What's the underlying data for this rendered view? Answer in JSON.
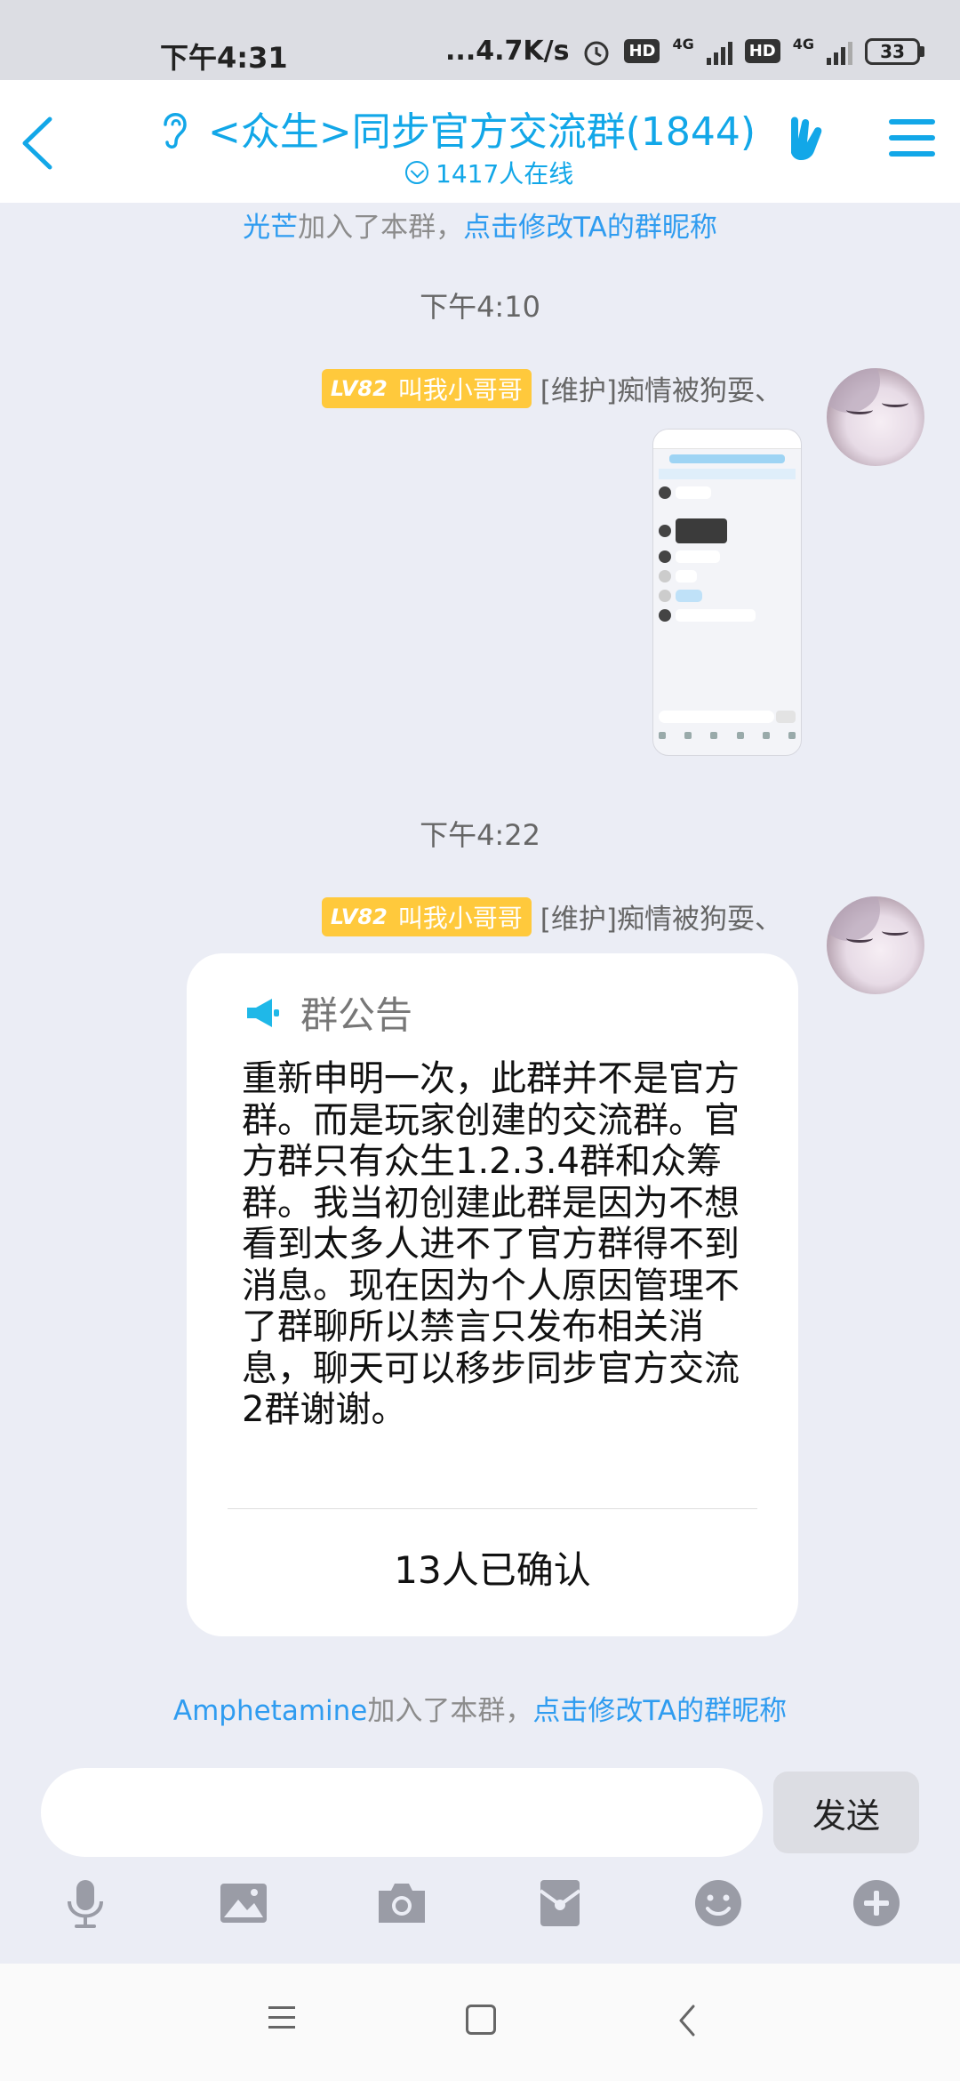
{
  "status_bar": {
    "time": "下午4:31",
    "network_speed": "...4.7K/s",
    "hd1": "HD",
    "hd2": "HD",
    "net1": "4G",
    "net2": "4G",
    "battery": "33"
  },
  "header": {
    "title": "<众生>同步官方交流群(1844)",
    "online_count": "1417人在线"
  },
  "chat": {
    "sys_top": {
      "name": "光芒",
      "text": "加入了本群，",
      "link": "点击修改TA的群昵称"
    },
    "messages": [
      {
        "time": "下午4:10",
        "level": "LV82",
        "title": "叫我小哥哥",
        "sender": "[维护]痴情被狗耍、",
        "type": "image"
      },
      {
        "time": "下午4:22",
        "level": "LV82",
        "title": "叫我小哥哥",
        "sender": "[维护]痴情被狗耍、",
        "type": "notice",
        "notice_title": "群公告",
        "notice_body": "重新申明一次，此群并不是官方群。而是玩家创建的交流群。官方群只有众生1.2.3.4群和众筹群。我当初创建此群是因为不想看到太多人进不了官方群得不到消息。现在因为个人原因管理不了群聊所以禁言只发布相关消息，聊天可以移步同步官方交流2群谢谢。",
        "notice_confirm": "13人已确认"
      }
    ],
    "sys_bottom": {
      "name": "Amphetamine",
      "text": "加入了本群，",
      "link": "点击修改TA的群昵称"
    }
  },
  "input": {
    "value": "",
    "send_label": "发送"
  },
  "colors": {
    "accent": "#12a7e8",
    "link": "#2f9cf0",
    "badge": "#ffc93c",
    "background": "#ebedf5"
  },
  "icons": {
    "toolbar": [
      "microphone-icon",
      "image-icon",
      "camera-icon",
      "red-packet-icon",
      "emoji-icon",
      "plus-icon"
    ]
  }
}
